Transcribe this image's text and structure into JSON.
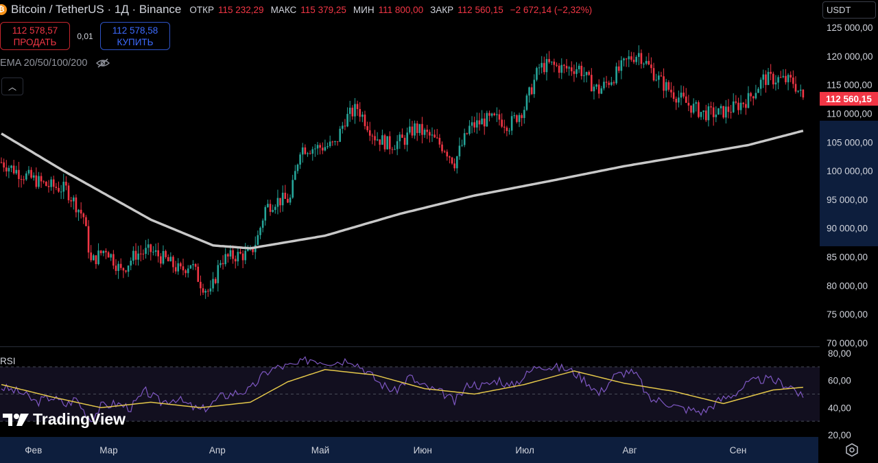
{
  "header": {
    "symbol": "Bitcoin / TetherUS · 1Д · Binance",
    "open_label": "ОТКР",
    "open": "115 232,29",
    "high_label": "МАКС",
    "high": "115 379,25",
    "low_label": "МИН",
    "low": "111 800,00",
    "close_label": "ЗАКР",
    "close": "112 560,15",
    "change": "−2 672,14 (−2,32%)"
  },
  "trade": {
    "sell_price": "112 578,57",
    "sell_label": "ПРОДАТЬ",
    "spread": "0,01",
    "buy_price": "112 578,58",
    "buy_label": "КУПИТЬ"
  },
  "indicator_label": "EMA 20/50/100/200",
  "currency": "USDT",
  "rsi_label": "RSI",
  "logo_text": "TradingView",
  "colors": {
    "up": "#26a69a",
    "down": "#f23645",
    "ema": "#c8c8c8",
    "rsi": "#7e57c2",
    "rsi_ma": "#e5c84a",
    "price_tag": "#f23645",
    "axis_bg": "#0d1e3d"
  },
  "chart_data": [
    {
      "type": "candlestick",
      "x": [
        "Фев",
        "Мар",
        "Апр",
        "Май",
        "Июн",
        "Июл",
        "Авг",
        "Сен"
      ],
      "ylim": [
        70000,
        125000
      ],
      "y_ticks": [
        "125 000,00",
        "120 000,00",
        "115 000,00",
        "110 000,00",
        "105 000,00",
        "100 000,00",
        "95 000,00",
        "90 000,00",
        "85 000,00",
        "80 000,00",
        "75 000,00",
        "70 000,00"
      ],
      "last_price": "112 560,15",
      "close_path": [
        [
          0,
          101500
        ],
        [
          8,
          99500
        ],
        [
          18,
          97500
        ],
        [
          26,
          96800
        ],
        [
          33,
          92000
        ],
        [
          36,
          84000
        ],
        [
          42,
          86500
        ],
        [
          48,
          82500
        ],
        [
          54,
          85500
        ],
        [
          60,
          86000
        ],
        [
          66,
          84500
        ],
        [
          72,
          82500
        ],
        [
          76,
          84000
        ],
        [
          80,
          80500
        ],
        [
          84,
          78500
        ],
        [
          88,
          84500
        ],
        [
          94,
          85200
        ],
        [
          100,
          85500
        ],
        [
          103,
          88500
        ],
        [
          106,
          93500
        ],
        [
          110,
          94800
        ],
        [
          116,
          95000
        ],
        [
          120,
          104000
        ],
        [
          126,
          104000
        ],
        [
          134,
          104500
        ],
        [
          138,
          109000
        ],
        [
          143,
          111000
        ],
        [
          150,
          106000
        ],
        [
          156,
          104500
        ],
        [
          162,
          105500
        ],
        [
          166,
          107500
        ],
        [
          172,
          106000
        ],
        [
          178,
          104000
        ],
        [
          182,
          101500
        ],
        [
          188,
          107500
        ],
        [
          194,
          108800
        ],
        [
          200,
          109000
        ],
        [
          204,
          108000
        ],
        [
          210,
          111000
        ],
        [
          216,
          118000
        ],
        [
          220,
          118500
        ],
        [
          226,
          117800
        ],
        [
          232,
          118000
        ],
        [
          236,
          115500
        ],
        [
          240,
          114000
        ],
        [
          246,
          116500
        ],
        [
          252,
          119500
        ],
        [
          256,
          120500
        ],
        [
          262,
          117000
        ],
        [
          266,
          115000
        ],
        [
          270,
          113500
        ],
        [
          276,
          111500
        ],
        [
          282,
          110000
        ],
        [
          288,
          110000
        ],
        [
          294,
          111000
        ],
        [
          300,
          112500
        ],
        [
          306,
          116000
        ],
        [
          312,
          116000
        ],
        [
          318,
          115500
        ],
        [
          322,
          112560
        ]
      ],
      "ema_path": [
        [
          0,
          106500
        ],
        [
          25,
          100000
        ],
        [
          60,
          91500
        ],
        [
          85,
          87000
        ],
        [
          100,
          86500
        ],
        [
          130,
          88700
        ],
        [
          160,
          92500
        ],
        [
          190,
          95700
        ],
        [
          220,
          98200
        ],
        [
          250,
          100800
        ],
        [
          280,
          103000
        ],
        [
          300,
          104500
        ],
        [
          323,
          107100
        ]
      ]
    },
    {
      "type": "line",
      "title": "RSI",
      "ylim": [
        20,
        80
      ],
      "y_ticks": [
        "80,00",
        "60,00",
        "40,00",
        "20,00"
      ],
      "bands": [
        70,
        50,
        30
      ],
      "series": [
        {
          "values": [
            [
              0,
              55
            ],
            [
              8,
              51
            ],
            [
              14,
              44
            ],
            [
              20,
              48
            ],
            [
              26,
              42
            ],
            [
              30,
              47
            ],
            [
              33,
              38
            ],
            [
              36,
              31
            ],
            [
              40,
              41
            ],
            [
              46,
              43
            ],
            [
              52,
              40
            ],
            [
              58,
              52
            ],
            [
              64,
              44
            ],
            [
              70,
              47
            ],
            [
              76,
              41
            ],
            [
              80,
              38
            ],
            [
              84,
              42
            ],
            [
              88,
              48
            ],
            [
              94,
              51
            ],
            [
              100,
              53
            ],
            [
              104,
              62
            ],
            [
              108,
              68
            ],
            [
              112,
              70
            ],
            [
              118,
              71
            ],
            [
              124,
              76
            ],
            [
              130,
              74
            ],
            [
              136,
              74
            ],
            [
              140,
              76
            ],
            [
              146,
              68
            ],
            [
              152,
              58
            ],
            [
              158,
              52
            ],
            [
              164,
              63
            ],
            [
              168,
              57
            ],
            [
              172,
              54
            ],
            [
              178,
              50
            ],
            [
              182,
              44
            ],
            [
              188,
              58
            ],
            [
              194,
              56
            ],
            [
              200,
              61
            ],
            [
              204,
              55
            ],
            [
              210,
              63
            ],
            [
              216,
              72
            ],
            [
              220,
              70
            ],
            [
              226,
              69
            ],
            [
              230,
              66
            ],
            [
              236,
              58
            ],
            [
              240,
              50
            ],
            [
              246,
              63
            ],
            [
              252,
              67
            ],
            [
              256,
              62
            ],
            [
              260,
              46
            ],
            [
              266,
              45
            ],
            [
              272,
              40
            ],
            [
              278,
              38
            ],
            [
              282,
              37
            ],
            [
              288,
              45
            ],
            [
              294,
              50
            ],
            [
              300,
              58
            ],
            [
              306,
              61
            ],
            [
              312,
              59
            ],
            [
              318,
              55
            ],
            [
              322,
              46
            ]
          ]
        },
        {
          "values": [
            [
              0,
              57
            ],
            [
              20,
              48
            ],
            [
              40,
              40
            ],
            [
              60,
              44
            ],
            [
              80,
              40
            ],
            [
              100,
              44
            ],
            [
              115,
              59
            ],
            [
              130,
              68
            ],
            [
              150,
              64
            ],
            [
              170,
              54
            ],
            [
              190,
              50
            ],
            [
              210,
              57
            ],
            [
              230,
              67
            ],
            [
              250,
              58
            ],
            [
              270,
              52
            ],
            [
              290,
              43
            ],
            [
              310,
              53
            ],
            [
              322,
              55
            ]
          ]
        }
      ]
    }
  ]
}
